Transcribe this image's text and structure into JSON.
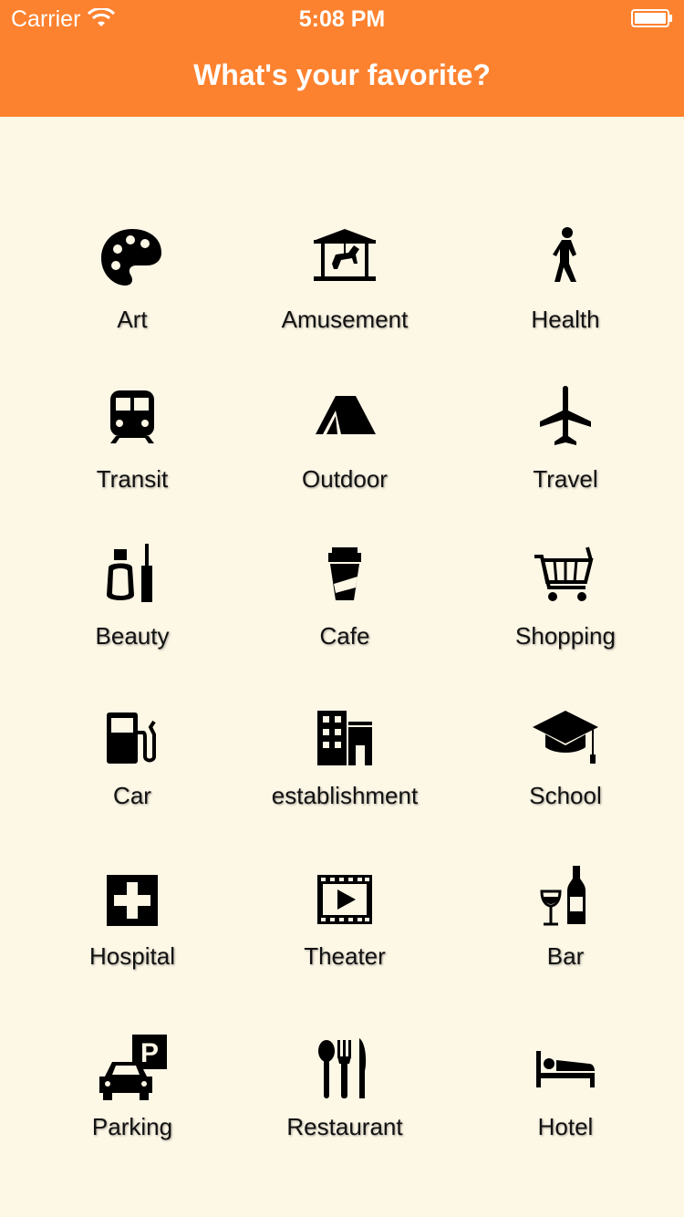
{
  "status_bar": {
    "carrier": "Carrier",
    "time": "5:08 PM"
  },
  "header": {
    "title": "What's your favorite?",
    "background_color": "#fd822f"
  },
  "background_color": "#fdf7e6",
  "categories": [
    {
      "label": "Art",
      "icon": "palette-icon"
    },
    {
      "label": "Amusement",
      "icon": "carousel-icon"
    },
    {
      "label": "Health",
      "icon": "walking-person-icon"
    },
    {
      "label": "Transit",
      "icon": "train-icon"
    },
    {
      "label": "Outdoor",
      "icon": "tent-icon"
    },
    {
      "label": "Travel",
      "icon": "airplane-icon"
    },
    {
      "label": "Beauty",
      "icon": "nail-polish-icon"
    },
    {
      "label": "Cafe",
      "icon": "coffee-cup-icon"
    },
    {
      "label": "Shopping",
      "icon": "shopping-cart-icon"
    },
    {
      "label": "Car",
      "icon": "gas-pump-icon"
    },
    {
      "label": "establishment",
      "icon": "buildings-icon"
    },
    {
      "label": "School",
      "icon": "graduation-cap-icon"
    },
    {
      "label": "Hospital",
      "icon": "medical-cross-icon"
    },
    {
      "label": "Theater",
      "icon": "film-strip-icon"
    },
    {
      "label": "Bar",
      "icon": "wine-icon"
    },
    {
      "label": "Parking",
      "icon": "parking-car-icon"
    },
    {
      "label": "Restaurant",
      "icon": "cutlery-icon"
    },
    {
      "label": "Hotel",
      "icon": "bed-icon"
    }
  ]
}
